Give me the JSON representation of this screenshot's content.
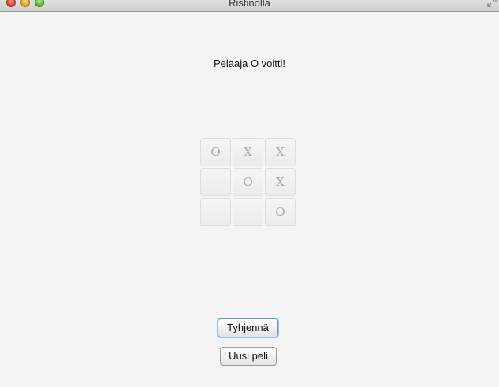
{
  "window": {
    "title": "Ristinolla"
  },
  "status": {
    "message": "Pelaaja O voitti!"
  },
  "board": {
    "cells": [
      "O",
      "X",
      "X",
      "",
      "O",
      "X",
      "",
      "",
      "O"
    ]
  },
  "buttons": {
    "clear_label": "Tyhjennä",
    "new_game_label": "Uusi peli"
  },
  "colors": {
    "background": "#f4f4f4",
    "mark": "#a8a8a8",
    "focus": "#5b9bd5"
  }
}
